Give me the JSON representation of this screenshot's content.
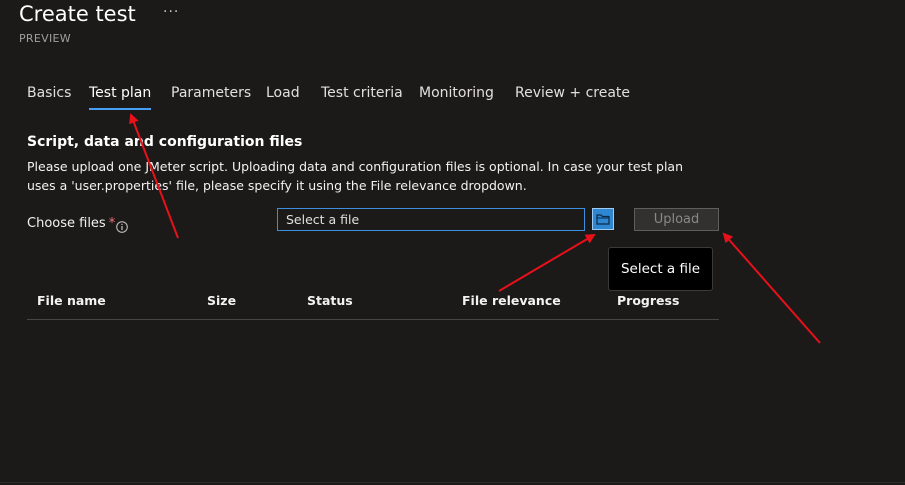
{
  "header": {
    "title": "Create test",
    "more_label": "···",
    "subtitle": "PREVIEW"
  },
  "tabs": [
    {
      "label": "Basics",
      "active": false
    },
    {
      "label": "Test plan",
      "active": true
    },
    {
      "label": "Parameters",
      "active": false
    },
    {
      "label": "Load",
      "active": false
    },
    {
      "label": "Test criteria",
      "active": false
    },
    {
      "label": "Monitoring",
      "active": false
    },
    {
      "label": "Review + create",
      "active": false
    }
  ],
  "section": {
    "title": "Script, data and configuration files",
    "description": "Please upload one JMeter script. Uploading data and configuration files is optional. In case your test plan uses a 'user.properties' file, please specify it using the File relevance dropdown."
  },
  "choose_files": {
    "label": "Choose files",
    "required_mark": "*",
    "info_icon": "info-icon",
    "placeholder": "Select a file",
    "browse_icon": "folder-icon",
    "upload_label": "Upload",
    "upload_enabled": false
  },
  "tooltip": {
    "text": "Select a file"
  },
  "table": {
    "columns": [
      "File name",
      "Size",
      "Status",
      "File relevance",
      "Progress"
    ],
    "rows": []
  },
  "colors": {
    "background": "#1b1a19",
    "accent": "#479ef5",
    "annotation_arrow": "#e8101a"
  }
}
